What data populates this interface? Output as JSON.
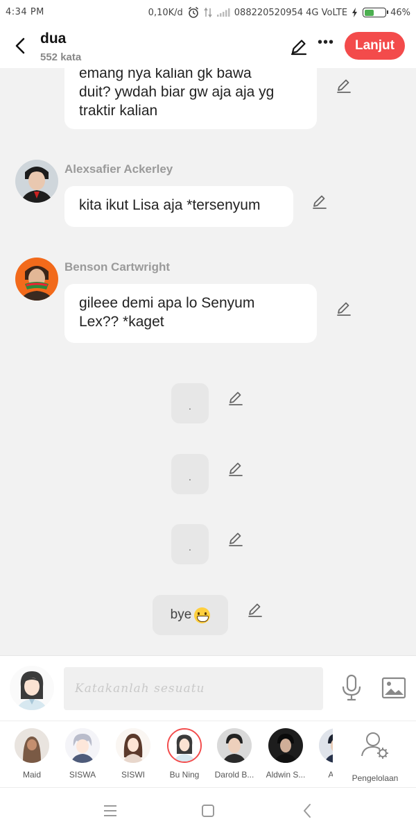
{
  "status_bar": {
    "time": "4:34 PM",
    "speed": "0,10K/d",
    "carrier": "088220520954 4G VoLTE",
    "battery_percent": "46%",
    "battery_level": 0.46
  },
  "header": {
    "title": "dua",
    "subtitle": "552 kata",
    "next_label": "Lanjut"
  },
  "messages": [
    {
      "sender": "",
      "lines": [
        "emang nya kalian gk bawa",
        "duit? ywdah biar gw aja aja yg",
        "traktir kalian"
      ]
    },
    {
      "sender": "Alexsafier Ackerley",
      "lines": [
        "kita ikut Lisa aja *tersenyum"
      ]
    },
    {
      "sender": "Benson Cartwright",
      "lines": [
        "gileee demi apa lo Senyum",
        "Lex?? *kaget"
      ]
    }
  ],
  "narration": [
    {
      "text": "."
    },
    {
      "text": "."
    },
    {
      "text": "."
    },
    {
      "text": "bye"
    }
  ],
  "composer": {
    "placeholder": "Katakanlah sesuatu"
  },
  "characters": [
    {
      "name": "Maid"
    },
    {
      "name": "SISWA"
    },
    {
      "name": "SISWI"
    },
    {
      "name": "Bu Ning",
      "selected": true
    },
    {
      "name": "Darold B..."
    },
    {
      "name": "Aldwin S..."
    },
    {
      "name": "Aike"
    }
  ],
  "manage_label": "Pengelolaan"
}
